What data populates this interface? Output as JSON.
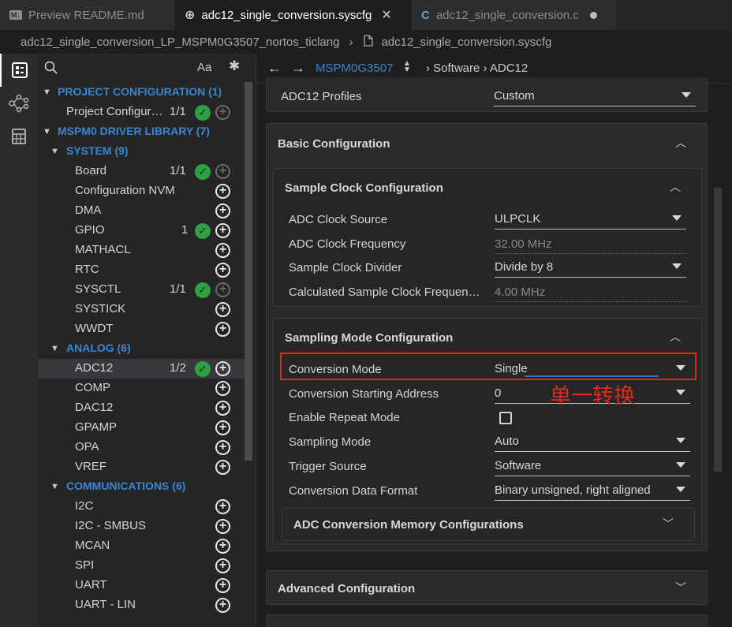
{
  "tabs": [
    {
      "icon": "M↓",
      "label": "Preview README.md"
    },
    {
      "icon": "globe",
      "label": "adc12_single_conversion.syscfg",
      "close": "✕"
    },
    {
      "icon": "C",
      "label": "adc12_single_conversion.c"
    }
  ],
  "breadcrumb": {
    "project": "adc12_single_conversion_LP_MSPM0G3507_nortos_ticlang",
    "sep": "›",
    "file": "adc12_single_conversion.syscfg"
  },
  "sidebar": {
    "aa": "Aa",
    "star": "✱",
    "rows": [
      {
        "label": "PROJECT CONFIGURATION (1)",
        "type": "cat",
        "level": 0
      },
      {
        "label": "Project Configur…",
        "count": "1/1",
        "check": true,
        "add": "dim",
        "level": 1
      },
      {
        "label": "MSPM0 DRIVER LIBRARY (7)",
        "type": "cat",
        "level": 0
      },
      {
        "label": "SYSTEM (9)",
        "type": "cat",
        "level": 1
      },
      {
        "label": "Board",
        "count": "1/1",
        "check": true,
        "add": "dim",
        "level": 2
      },
      {
        "label": "Configuration NVM",
        "add": "on",
        "level": 2
      },
      {
        "label": "DMA",
        "add": "on",
        "level": 2
      },
      {
        "label": "GPIO",
        "count": "1",
        "check": true,
        "add": "on",
        "level": 2
      },
      {
        "label": "MATHACL",
        "add": "on",
        "level": 2
      },
      {
        "label": "RTC",
        "add": "on",
        "level": 2
      },
      {
        "label": "SYSCTL",
        "count": "1/1",
        "check": true,
        "add": "dim",
        "level": 2
      },
      {
        "label": "SYSTICK",
        "add": "on",
        "level": 2
      },
      {
        "label": "WWDT",
        "add": "on",
        "level": 2
      },
      {
        "label": "ANALOG (6)",
        "type": "cat",
        "level": 1
      },
      {
        "label": "ADC12",
        "count": "1/2",
        "check": true,
        "add": "on",
        "level": 2,
        "selected": true
      },
      {
        "label": "COMP",
        "add": "on",
        "level": 2
      },
      {
        "label": "DAC12",
        "add": "on",
        "level": 2
      },
      {
        "label": "GPAMP",
        "add": "on",
        "level": 2
      },
      {
        "label": "OPA",
        "add": "on",
        "level": 2
      },
      {
        "label": "VREF",
        "add": "on",
        "level": 2
      },
      {
        "label": "COMMUNICATIONS (6)",
        "type": "cat",
        "level": 1
      },
      {
        "label": "I2C",
        "add": "on",
        "level": 2
      },
      {
        "label": "I2C - SMBUS",
        "add": "on",
        "level": 2
      },
      {
        "label": "MCAN",
        "add": "on",
        "level": 2
      },
      {
        "label": "SPI",
        "add": "on",
        "level": 2
      },
      {
        "label": "UART",
        "add": "on",
        "level": 2
      },
      {
        "label": "UART - LIN",
        "add": "on",
        "level": 2
      }
    ]
  },
  "nav": {
    "back": "←",
    "forward": "→",
    "device": "MSPM0G3507",
    "path": "› Software › ADC12"
  },
  "main": {
    "profiles": {
      "label": "ADC12 Profiles",
      "value": "Custom"
    },
    "basic_title": "Basic Configuration",
    "sample_clock": {
      "title": "Sample Clock Configuration",
      "clock_source": {
        "label": "ADC Clock Source",
        "value": "ULPCLK"
      },
      "clock_freq": {
        "label": "ADC Clock Frequency",
        "value": "32.00 MHz"
      },
      "divider": {
        "label": "Sample Clock Divider",
        "value": "Divide by 8"
      },
      "calc_freq": {
        "label": "Calculated Sample Clock Frequen…",
        "value": "4.00 MHz"
      }
    },
    "sampling_mode": {
      "title": "Sampling Mode Configuration",
      "conversion_mode": {
        "label": "Conversion Mode",
        "value": "Single"
      },
      "start_addr": {
        "label": "Conversion Starting Address",
        "value": "0"
      },
      "repeat": {
        "label": "Enable Repeat Mode"
      },
      "sampling": {
        "label": "Sampling Mode",
        "value": "Auto"
      },
      "trigger": {
        "label": "Trigger Source",
        "value": "Software"
      },
      "data_format": {
        "label": "Conversion Data Format",
        "value": "Binary unsigned, right aligned"
      }
    },
    "memory_title": "ADC Conversion Memory Configurations",
    "advanced_title": "Advanced Configuration"
  },
  "annotation": "单一转换",
  "colors": {
    "accent": "#3a86d1",
    "check": "#2ea043",
    "annotation": "#e0281c"
  }
}
